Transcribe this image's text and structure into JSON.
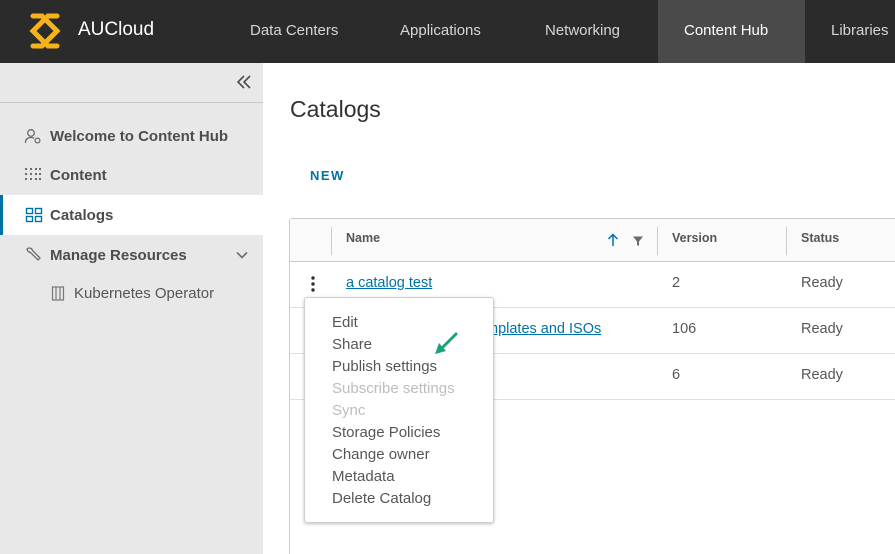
{
  "app": {
    "brand": "AUCloud"
  },
  "nav": {
    "tabs": [
      {
        "label": "Data Centers"
      },
      {
        "label": "Applications"
      },
      {
        "label": "Networking"
      },
      {
        "label": "Content Hub"
      },
      {
        "label": "Libraries"
      }
    ],
    "active_tab": "Content Hub"
  },
  "sidebar": {
    "collapse_glyph": "«",
    "items": [
      {
        "label": "Welcome to Content Hub",
        "icon": "user-gear-icon"
      },
      {
        "label": "Content",
        "icon": "grid-dots-icon"
      },
      {
        "label": "Catalogs",
        "icon": "catalog-icon",
        "active": true
      },
      {
        "label": "Manage Resources",
        "icon": "wrench-icon"
      }
    ],
    "subitems": [
      {
        "label": "Kubernetes Operator",
        "icon": "building-icon"
      }
    ]
  },
  "main": {
    "title": "Catalogs",
    "new_label": "NEW"
  },
  "grid": {
    "columns": [
      "Name",
      "Version",
      "Status"
    ],
    "rows": [
      {
        "name": "a catalog test",
        "version": "2",
        "status": "Ready"
      },
      {
        "name": "mplates and ISOs",
        "version": "106",
        "status": "Ready"
      },
      {
        "name": "",
        "version": "6",
        "status": "Ready"
      }
    ]
  },
  "context_menu": {
    "items": [
      {
        "label": "Edit",
        "enabled": true
      },
      {
        "label": "Share",
        "enabled": true
      },
      {
        "label": "Publish settings",
        "enabled": true
      },
      {
        "label": "Subscribe settings",
        "enabled": false
      },
      {
        "label": "Sync",
        "enabled": false
      },
      {
        "label": "Storage Policies",
        "enabled": true
      },
      {
        "label": "Change owner",
        "enabled": true
      },
      {
        "label": "Metadata",
        "enabled": true
      },
      {
        "label": "Delete Catalog",
        "enabled": true
      }
    ]
  },
  "colors": {
    "topbar": "#2b2b2b",
    "accent": "#0072a3",
    "logo": "#f5b21a",
    "annotation": "#1aa37a"
  }
}
